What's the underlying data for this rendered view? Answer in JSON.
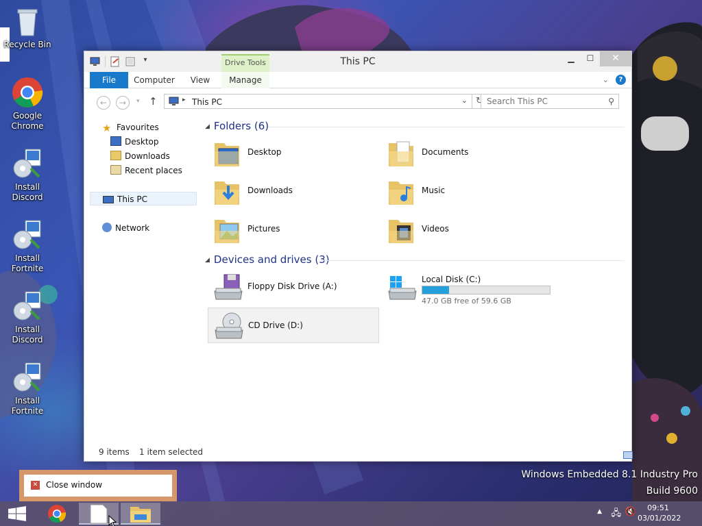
{
  "desktop": {
    "icons": [
      {
        "label": "Recycle Bin",
        "icon": "recycle-bin-icon"
      },
      {
        "label": "Google Chrome",
        "icon": "chrome-icon"
      },
      {
        "label": "Install Discord",
        "icon": "installer-icon"
      },
      {
        "label": "Install Fortnite",
        "icon": "installer-icon"
      },
      {
        "label": "Install Discord",
        "icon": "installer-icon"
      },
      {
        "label": "Install Fortnite",
        "icon": "installer-icon"
      }
    ]
  },
  "window": {
    "title": "This PC",
    "context_tab": "Drive Tools",
    "tabs": [
      "File",
      "Computer",
      "View",
      "Manage"
    ],
    "address": "This PC",
    "search_placeholder": "Search This PC",
    "nav": {
      "favourites": "Favourites",
      "fav_items": [
        "Desktop",
        "Downloads",
        "Recent places"
      ],
      "this_pc": "This PC",
      "network": "Network"
    },
    "folders_header": "Folders (6)",
    "folders": [
      "Desktop",
      "Documents",
      "Downloads",
      "Music",
      "Pictures",
      "Videos"
    ],
    "devices_header": "Devices and drives (3)",
    "devices": {
      "floppy": "Floppy Disk Drive (A:)",
      "local": "Local Disk (C:)",
      "local_free": "47.0 GB free of 59.6 GB",
      "local_used_fraction": 0.21,
      "cd": "CD Drive (D:)"
    },
    "status": {
      "items": "9 items",
      "selected": "1 item selected"
    }
  },
  "toast": {
    "text": "Close window"
  },
  "watermark": {
    "line1": "Windows Embedded 8.1 Industry Pro",
    "line2": "Build 9600"
  },
  "taskbar": {
    "time": "09:51",
    "date": "03/01/2022"
  },
  "colors": {
    "accent": "#1979ca",
    "drive_bar": "#26a0da",
    "context_tab": "#9ccf6c"
  }
}
